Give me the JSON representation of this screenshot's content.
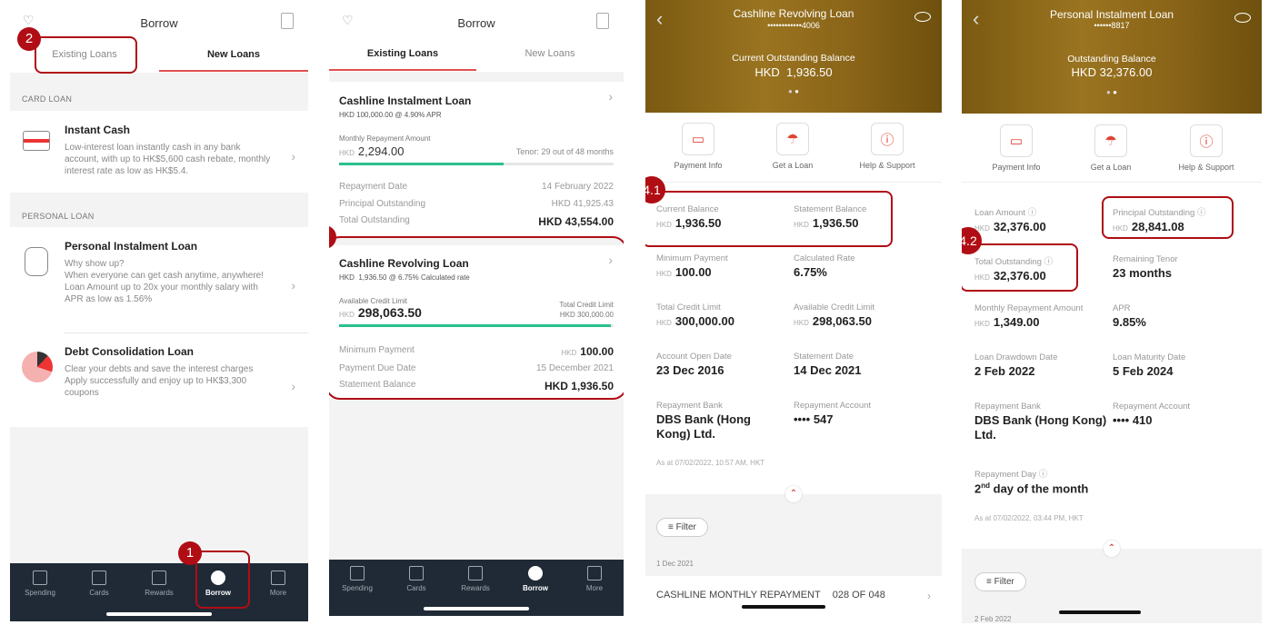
{
  "colors": {
    "accent": "#e05050",
    "annotation": "#b00d14",
    "progress": "#2bbf8f",
    "nav_bg": "#1f2a36",
    "gold": "#8a6418"
  },
  "nav": [
    {
      "label": "Spending",
      "icon": "receipt-icon"
    },
    {
      "label": "Cards",
      "icon": "card-icon"
    },
    {
      "label": "Rewards",
      "icon": "gift-icon"
    },
    {
      "label": "Borrow",
      "icon": "borrow-icon",
      "active": true
    },
    {
      "label": "More",
      "icon": "grid-icon"
    }
  ],
  "panel1": {
    "title": "Borrow",
    "tabs": [
      "Existing Loans",
      "New Loans"
    ],
    "active_tab": "New Loans",
    "sections": [
      {
        "label": "CARD LOAN"
      },
      {
        "label": "PERSONAL LOAN"
      }
    ],
    "products": [
      {
        "title": "Instant Cash",
        "desc": "Low-interest loan instantly cash in any bank account, with up to HK$5,600 cash rebate, monthly interest rate as low as HK$5.4."
      },
      {
        "title": "Personal Instalment Loan",
        "desc": "Why show up?\nWhen everyone can get cash anytime, anywhere!\nLoan Amount up to 20x your monthly salary with APR as low as 1.56%"
      },
      {
        "title": "Debt Consolidation Loan",
        "desc": "Clear your debts and save the interest charges\nApply successfully and enjoy up to HK$3,300 coupons"
      }
    ]
  },
  "panel2": {
    "title": "Borrow",
    "tabs": [
      "Existing Loans",
      "New Loans"
    ],
    "active_tab": "Existing Loans",
    "loan1": {
      "title": "Cashline Instalment Loan",
      "sub": "HKD 100,000.00 @ 4.90% APR",
      "amount_label": "Monthly Repayment Amount",
      "cur": "HKD",
      "amount": "2,294.00",
      "tenor": "Tenor: 29 out of 48 months",
      "progress": 0.6,
      "rows": [
        [
          "Repayment Date",
          "14 February 2022"
        ],
        [
          "Principal Outstanding",
          "HKD 41,925.43"
        ],
        [
          "Total Outstanding",
          "HKD 43,554.00"
        ]
      ]
    },
    "loan2": {
      "title": "Cashline Revolving Loan",
      "sub": "HKD  1,936.50 @ 6.75% Calculated rate",
      "amount_label": "Available Credit Limit",
      "cur": "HKD",
      "amount": "298,063.50",
      "limit_label": "Total Credit Limit",
      "limit": "HKD 300,000.00",
      "progress": 0.99,
      "rows": [
        [
          "Minimum Payment",
          "100.00"
        ],
        [
          "Payment Due Date",
          "15 December 2021"
        ],
        [
          "Statement Balance",
          "HKD 1,936.50"
        ]
      ],
      "row0_cur": "HKD"
    }
  },
  "actions": [
    "Payment Info",
    "Get a Loan",
    "Help & Support"
  ],
  "panel3": {
    "title": "Cashline Revolving Loan",
    "acct": "••••••••••••4006",
    "bal_label": "Current Outstanding Balance",
    "bal": "HKD  1,936.50",
    "fields": [
      [
        "Current Balance",
        "HKD",
        "1,936.50"
      ],
      [
        "Statement Balance",
        "HKD",
        "1,936.50"
      ],
      [
        "Minimum Payment",
        "HKD",
        "100.00"
      ],
      [
        "Calculated Rate",
        "",
        "6.75%"
      ],
      [
        "Total Credit Limit",
        "HKD",
        "300,000.00"
      ],
      [
        "Available Credit Limit",
        "HKD",
        "298,063.50"
      ],
      [
        "Account Open Date",
        "",
        "23 Dec 2016"
      ],
      [
        "Statement Date",
        "",
        "14 Dec 2021"
      ],
      [
        "Repayment Bank",
        "",
        "DBS Bank (Hong Kong) Ltd."
      ],
      [
        "Repayment Account",
        "",
        "•••• 547"
      ]
    ],
    "asat": "As at 07/02/2022, 10:57 AM, HKT",
    "filter": "Filter",
    "date": "1 Dec 2021",
    "txn": "CASHLINE MONTHLY REPAYMENT",
    "txn_no": "028 OF 048"
  },
  "panel4": {
    "title": "Personal Instalment Loan",
    "acct": "••••••8817",
    "bal_label": "Outstanding Balance",
    "bal": "HKD 32,376.00",
    "fields": [
      [
        "Loan Amount",
        "HKD",
        "32,376.00"
      ],
      [
        "Principal Outstanding",
        "HKD",
        "28,841.08"
      ],
      [
        "Total Outstanding",
        "HKD",
        "32,376.00"
      ],
      [
        "Remaining Tenor",
        "",
        "23 months"
      ],
      [
        "Monthly Repayment Amount",
        "HKD",
        "1,349.00"
      ],
      [
        "APR",
        "",
        "9.85%"
      ],
      [
        "Loan Drawdown Date",
        "",
        "2 Feb 2022"
      ],
      [
        "Loan Maturity Date",
        "",
        "5 Feb 2024"
      ],
      [
        "Repayment Bank",
        "",
        "DBS Bank (Hong Kong) Ltd."
      ],
      [
        "Repayment Account",
        "",
        "•••• 410"
      ]
    ],
    "repay_day_label": "Repayment Day",
    "repay_day_num": "2",
    "repay_day_sup": "nd",
    "repay_day_rest": " day of the month",
    "asat": "As at 07/02/2022, 03:44 PM, HKT",
    "filter": "Filter",
    "date": "2 Feb 2022"
  },
  "annotations": [
    "1",
    "2",
    "3",
    "4.1",
    "4.2"
  ]
}
